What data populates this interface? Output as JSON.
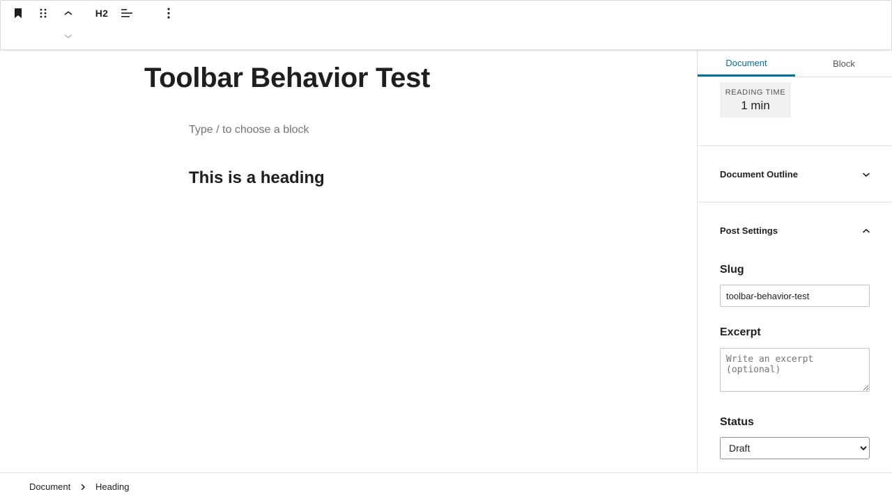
{
  "toolbar": {
    "heading_level": "H2",
    "icons": [
      "bookmark-icon",
      "drag-handle-icon",
      "chevron-up-icon",
      "chevron-down-icon",
      "align-icon",
      "more-vertical-icon"
    ]
  },
  "editor": {
    "title": "Toolbar Behavior Test",
    "appender_placeholder": "Type / to choose a block",
    "heading_text": "This is a heading"
  },
  "sidebar": {
    "tabs": [
      {
        "label": "Document",
        "active": true
      },
      {
        "label": "Block",
        "active": false
      }
    ],
    "reading_time": {
      "label": "READING TIME",
      "value": "1 min"
    },
    "document_outline": {
      "label": "Document Outline",
      "expanded": false
    },
    "post_settings": {
      "label": "Post Settings",
      "expanded": true
    },
    "slug": {
      "label": "Slug",
      "value": "toolbar-behavior-test"
    },
    "excerpt": {
      "label": "Excerpt",
      "placeholder": "Write an excerpt (optional)"
    },
    "status": {
      "label": "Status",
      "value": "Draft",
      "options": [
        "Draft"
      ]
    }
  },
  "footer": {
    "breadcrumbs": [
      "Document",
      "Heading"
    ]
  },
  "colors": {
    "accent": "#0071a1",
    "text": "#1e1e1e",
    "muted": "#757575",
    "border": "#e0e0e0"
  }
}
